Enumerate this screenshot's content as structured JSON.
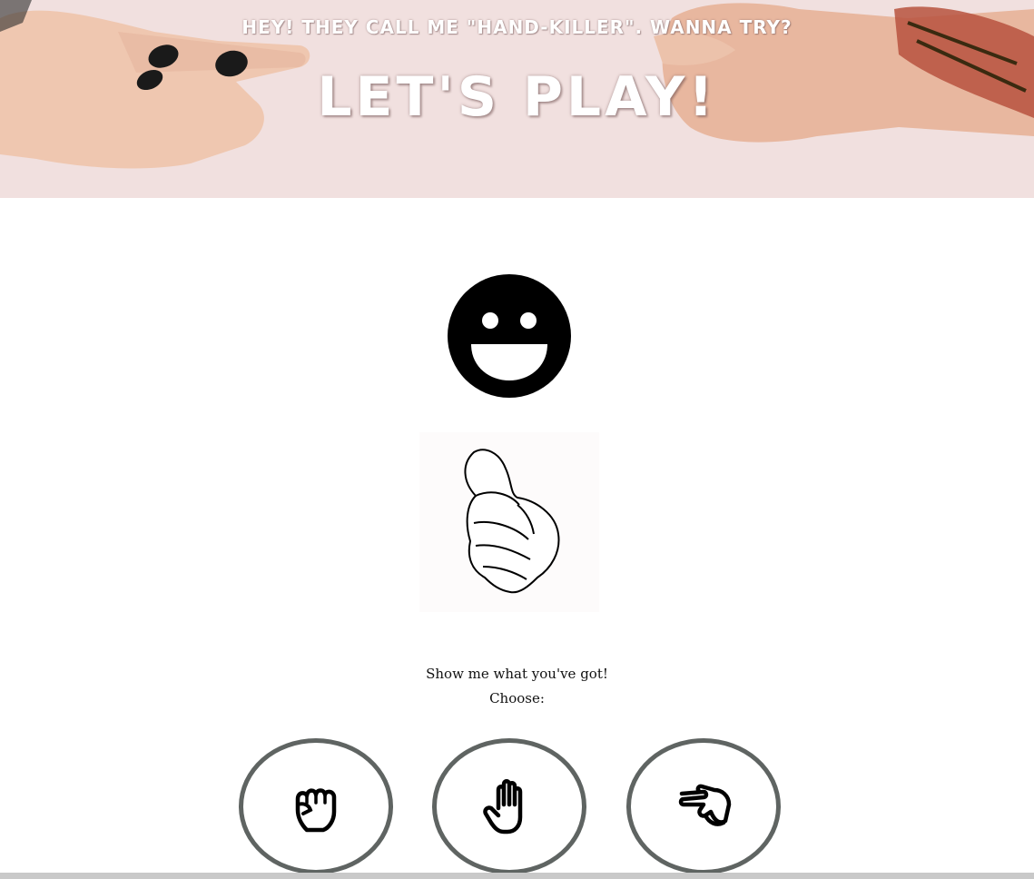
{
  "hero": {
    "tagline": "HEY! THEY CALL ME \"HAND-KILLER\". WANNA TRY?",
    "title": "LET'S PLAY!",
    "background_color": "#f1e0df"
  },
  "status": {
    "face_icon": "grinning-face-icon",
    "hand_icon": "pointing-at-you-hand-icon"
  },
  "prompt": {
    "line1": "Show me what you've got!",
    "line2": "Choose:"
  },
  "choices": [
    {
      "id": "rock",
      "icon": "fist-icon"
    },
    {
      "id": "paper",
      "icon": "open-hand-icon"
    },
    {
      "id": "scissors",
      "icon": "peace-hand-icon"
    }
  ],
  "colors": {
    "circle_border": "#5f6462",
    "icon": "#000000"
  }
}
